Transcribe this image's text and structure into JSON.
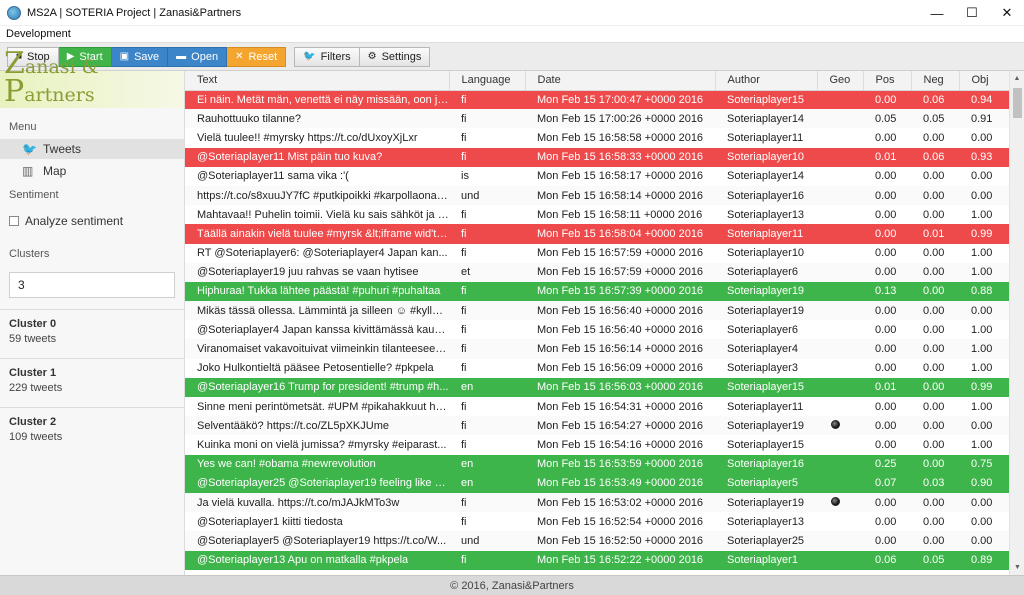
{
  "window": {
    "title": "MS2A | SOTERIA Project | Zanasi&Partners",
    "controls": {
      "minimize": "—",
      "maximize": "☐",
      "close": "✕"
    }
  },
  "menubar": {
    "items": [
      "Development"
    ]
  },
  "toolbar": {
    "stop": {
      "label": "Stop",
      "icon": "stop-icon"
    },
    "start": {
      "label": "Start",
      "icon": "play-icon"
    },
    "save": {
      "label": "Save",
      "icon": "save-icon"
    },
    "open": {
      "label": "Open",
      "icon": "folder-icon"
    },
    "reset": {
      "label": "Reset",
      "icon": "close-icon"
    },
    "filters": {
      "label": "Filters",
      "icon": "twitter-icon"
    },
    "settings": {
      "label": "Settings",
      "icon": "gear-icon"
    }
  },
  "sidebar": {
    "logo": {
      "text": "Zanasi & Partners"
    },
    "menu_label": "Menu",
    "menu_items": [
      {
        "label": "Tweets",
        "icon": "twitter-icon",
        "active": true
      },
      {
        "label": "Map",
        "icon": "map-icon",
        "active": false
      }
    ],
    "sentiment_label": "Sentiment",
    "analyze_label": "Analyze sentiment",
    "clusters_label": "Clusters",
    "clusters_value": "3",
    "clusters": [
      {
        "name": "Cluster 0",
        "count": "59 tweets"
      },
      {
        "name": "Cluster 1",
        "count": "229 tweets"
      },
      {
        "name": "Cluster 2",
        "count": "109 tweets"
      }
    ]
  },
  "table": {
    "columns": [
      "Text",
      "Language",
      "Date",
      "Author",
      "Geo",
      "Pos",
      "Neg",
      "Obj"
    ],
    "rows": [
      {
        "text": "Ei näin. Metät män, venettä ei näy missään, oon ju...",
        "lang": "fi",
        "date": "Mon Feb 15 17:00:47 +0000 2016",
        "author": "Soteriaplayer15",
        "geo": false,
        "pos": "0.00",
        "neg": "0.06",
        "obj": "0.94",
        "color": "red"
      },
      {
        "text": "Rauhottuuko tilanne?",
        "lang": "fi",
        "date": "Mon Feb 15 17:00:26 +0000 2016",
        "author": "Soteriaplayer14",
        "geo": false,
        "pos": "0.05",
        "neg": "0.05",
        "obj": "0.91",
        "color": ""
      },
      {
        "text": "Vielä tuulee!! #myrsky https://t.co/dUxoyXjLxr",
        "lang": "fi",
        "date": "Mon Feb 15 16:58:58 +0000 2016",
        "author": "Soteriaplayer11",
        "geo": false,
        "pos": "0.00",
        "neg": "0.00",
        "obj": "0.00",
        "color": ""
      },
      {
        "text": "@Soteriaplayer11 Mist päin tuo kuva?",
        "lang": "fi",
        "date": "Mon Feb 15 16:58:33 +0000 2016",
        "author": "Soteriaplayer10",
        "geo": false,
        "pos": "0.01",
        "neg": "0.06",
        "obj": "0.93",
        "color": "red"
      },
      {
        "text": "@Soteriaplayer11 sama vika :'(",
        "lang": "is",
        "date": "Mon Feb 15 16:58:17 +0000 2016",
        "author": "Soteriaplayer14",
        "geo": false,
        "pos": "0.00",
        "neg": "0.00",
        "obj": "0.00",
        "color": ""
      },
      {
        "text": "https://t.co/s8xuuJY7fC #putkipoikki #karpollaonas...",
        "lang": "und",
        "date": "Mon Feb 15 16:58:14 +0000 2016",
        "author": "Soteriaplayer16",
        "geo": false,
        "pos": "0.00",
        "neg": "0.00",
        "obj": "0.00",
        "color": ""
      },
      {
        "text": "Mahtavaa!! Puhelin toimii. Vielä ku sais sähköt ja t...",
        "lang": "fi",
        "date": "Mon Feb 15 16:58:11 +0000 2016",
        "author": "Soteriaplayer13",
        "geo": false,
        "pos": "0.00",
        "neg": "0.00",
        "obj": "1.00",
        "color": ""
      },
      {
        "text": "Täällä ainakin vielä tuulee #myrsk &lt;iframe wid'th...",
        "lang": "fi",
        "date": "Mon Feb 15 16:58:04 +0000 2016",
        "author": "Soteriaplayer11",
        "geo": false,
        "pos": "0.00",
        "neg": "0.01",
        "obj": "0.99",
        "color": "red"
      },
      {
        "text": "RT @Soteriaplayer6: @Soteriaplayer4 Japan kan...",
        "lang": "fi",
        "date": "Mon Feb 15 16:57:59 +0000 2016",
        "author": "Soteriaplayer10",
        "geo": false,
        "pos": "0.00",
        "neg": "0.00",
        "obj": "1.00",
        "color": ""
      },
      {
        "text": "@Soteriaplayer19 juu rahvas se vaan hytisee",
        "lang": "et",
        "date": "Mon Feb 15 16:57:59 +0000 2016",
        "author": "Soteriaplayer6",
        "geo": false,
        "pos": "0.00",
        "neg": "0.00",
        "obj": "1.00",
        "color": ""
      },
      {
        "text": "Hiphuraa! Tukka lähtee päästä! #puhuri #puhaltaa",
        "lang": "fi",
        "date": "Mon Feb 15 16:57:39 +0000 2016",
        "author": "Soteriaplayer19",
        "geo": false,
        "pos": "0.13",
        "neg": "0.00",
        "obj": "0.88",
        "color": "green"
      },
      {
        "text": "Mikäs tässä ollessa. Lämmintä ja silleen ☺ #kyllät...",
        "lang": "fi",
        "date": "Mon Feb 15 16:56:40 +0000 2016",
        "author": "Soteriaplayer19",
        "geo": false,
        "pos": "0.00",
        "neg": "0.00",
        "obj": "0.00",
        "color": ""
      },
      {
        "text": "@Soteriaplayer4 Japan kanssa kivittämässä kaup...",
        "lang": "fi",
        "date": "Mon Feb 15 16:56:40 +0000 2016",
        "author": "Soteriaplayer6",
        "geo": false,
        "pos": "0.00",
        "neg": "0.00",
        "obj": "1.00",
        "color": ""
      },
      {
        "text": "Viranomaiset vakavoituivat viimeinkin tilanteeseen...",
        "lang": "fi",
        "date": "Mon Feb 15 16:56:14 +0000 2016",
        "author": "Soteriaplayer4",
        "geo": false,
        "pos": "0.00",
        "neg": "0.00",
        "obj": "1.00",
        "color": ""
      },
      {
        "text": "Joko Hulkontieltä pääsee Petosentielle? #pkpela",
        "lang": "fi",
        "date": "Mon Feb 15 16:56:09 +0000 2016",
        "author": "Soteriaplayer3",
        "geo": false,
        "pos": "0.00",
        "neg": "0.00",
        "obj": "1.00",
        "color": ""
      },
      {
        "text": "@Soteriaplayer16 Trump for president! #trump #h...",
        "lang": "en",
        "date": "Mon Feb 15 16:56:03 +0000 2016",
        "author": "Soteriaplayer15",
        "geo": false,
        "pos": "0.01",
        "neg": "0.00",
        "obj": "0.99",
        "color": "green"
      },
      {
        "text": "Sinne meni perintömetsät. #UPM #pikahakkuut htt...",
        "lang": "fi",
        "date": "Mon Feb 15 16:54:31 +0000 2016",
        "author": "Soteriaplayer11",
        "geo": false,
        "pos": "0.00",
        "neg": "0.00",
        "obj": "1.00",
        "color": ""
      },
      {
        "text": "Selventääkö? https://t.co/ZL5pXKJUme",
        "lang": "fi",
        "date": "Mon Feb 15 16:54:27 +0000 2016",
        "author": "Soteriaplayer19",
        "geo": true,
        "pos": "0.00",
        "neg": "0.00",
        "obj": "0.00",
        "color": ""
      },
      {
        "text": "Kuinka moni on vielä jumissa? #myrsky #eiparast...",
        "lang": "fi",
        "date": "Mon Feb 15 16:54:16 +0000 2016",
        "author": "Soteriaplayer15",
        "geo": false,
        "pos": "0.00",
        "neg": "0.00",
        "obj": "1.00",
        "color": ""
      },
      {
        "text": "Yes we can! #obama #newrevolution",
        "lang": "en",
        "date": "Mon Feb 15 16:53:59 +0000 2016",
        "author": "Soteriaplayer16",
        "geo": false,
        "pos": "0.25",
        "neg": "0.00",
        "obj": "0.75",
        "color": "green"
      },
      {
        "text": "@Soteriaplayer25 @Soteriaplayer19 feeling like s...",
        "lang": "en",
        "date": "Mon Feb 15 16:53:49 +0000 2016",
        "author": "Soteriaplayer5",
        "geo": false,
        "pos": "0.07",
        "neg": "0.03",
        "obj": "0.90",
        "color": "green"
      },
      {
        "text": "Ja vielä kuvalla. https://t.co/mJAJkMTo3w",
        "lang": "fi",
        "date": "Mon Feb 15 16:53:02 +0000 2016",
        "author": "Soteriaplayer19",
        "geo": true,
        "pos": "0.00",
        "neg": "0.00",
        "obj": "0.00",
        "color": ""
      },
      {
        "text": "@Soteriaplayer1 kiitti tiedosta",
        "lang": "fi",
        "date": "Mon Feb 15 16:52:54 +0000 2016",
        "author": "Soteriaplayer13",
        "geo": false,
        "pos": "0.00",
        "neg": "0.00",
        "obj": "0.00",
        "color": ""
      },
      {
        "text": "@Soteriaplayer5 @Soteriaplayer19 https://t.co/W...",
        "lang": "und",
        "date": "Mon Feb 15 16:52:50 +0000 2016",
        "author": "Soteriaplayer25",
        "geo": false,
        "pos": "0.00",
        "neg": "0.00",
        "obj": "0.00",
        "color": ""
      },
      {
        "text": "@Soteriaplayer13 Apu on matkalla #pkpela",
        "lang": "fi",
        "date": "Mon Feb 15 16:52:22 +0000 2016",
        "author": "Soteriaplayer1",
        "geo": false,
        "pos": "0.06",
        "neg": "0.05",
        "obj": "0.89",
        "color": "green"
      }
    ]
  },
  "footer": {
    "text": "© 2016, Zanasi&Partners"
  }
}
